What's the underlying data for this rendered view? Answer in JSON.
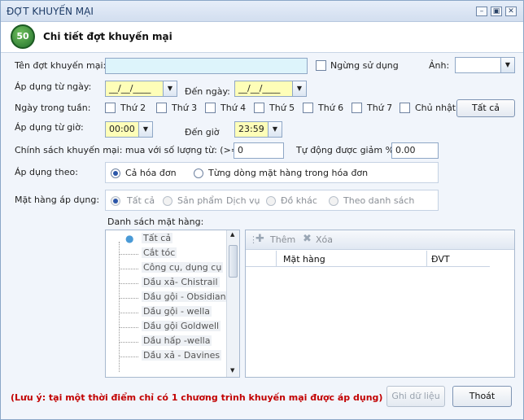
{
  "window": {
    "title": "ĐỢT KHUYẾN MẠI",
    "controls": [
      "–",
      "▣",
      "✕"
    ]
  },
  "header": {
    "logo_text": "50",
    "title": "Chi tiết đợt khuyến mại"
  },
  "form": {
    "name_label": "Tên đợt khuyến mại:",
    "name_value": "",
    "stop_use_label": "Ngừng sử dụng",
    "image_label": "Ảnh:",
    "image_value": "",
    "from_date_label": "Áp dụng từ ngày:",
    "from_date_value": "__/__/____",
    "to_date_label": "Đến ngày:",
    "to_date_value": "__/__/____",
    "weekdays_label": "Ngày trong tuần:",
    "weekdays": [
      "Thứ 2",
      "Thứ 3",
      "Thứ 4",
      "Thứ 5",
      "Thứ 6",
      "Thứ 7",
      "Chủ nhật"
    ],
    "select_all_label": "Tất cả",
    "from_time_label": "Áp dụng từ giờ:",
    "from_time_value": "00:00",
    "to_time_label": "Đến giờ",
    "to_time_value": "23:59",
    "policy_label": "Chính sách khuyến mại: mua với số lượng từ: (>=)",
    "policy_qty_value": "0",
    "auto_discount_label": "Tự động được giảm %:",
    "auto_discount_value": "0.00",
    "apply_by_label": "Áp dụng theo:",
    "apply_by_options": [
      "Cả hóa đơn",
      "Từng dòng mặt hàng trong hóa đơn"
    ],
    "applied_items_label": "Mặt hàng áp dụng:",
    "applied_items_options": [
      "Tất cả",
      "Sản phẩm",
      "Dịch vụ",
      "Đồ khác",
      "Theo danh sách"
    ],
    "item_list_label": "Danh sách mặt hàng:"
  },
  "tree": {
    "items": [
      "Tất cả",
      "Cắt tóc",
      "Công cụ, dụng cụ",
      "Dầu  xả- Chistrail",
      "Dầu gội - Obsidian",
      "Dầu gội - wella",
      "Dầu gội Goldwell",
      "Dầu hấp -wella",
      "Dầu xả - Davines"
    ]
  },
  "grid": {
    "add_label": "Thêm",
    "delete_label": "Xóa",
    "columns": [
      "Mặt hàng",
      "ĐVT"
    ]
  },
  "footer": {
    "note": "(Lưu ý: tại một thời điểm chỉ có 1 chương trình khuyến mại được áp dụng)",
    "save_label": "Ghi dữ liệu",
    "exit_label": "Thoát"
  }
}
